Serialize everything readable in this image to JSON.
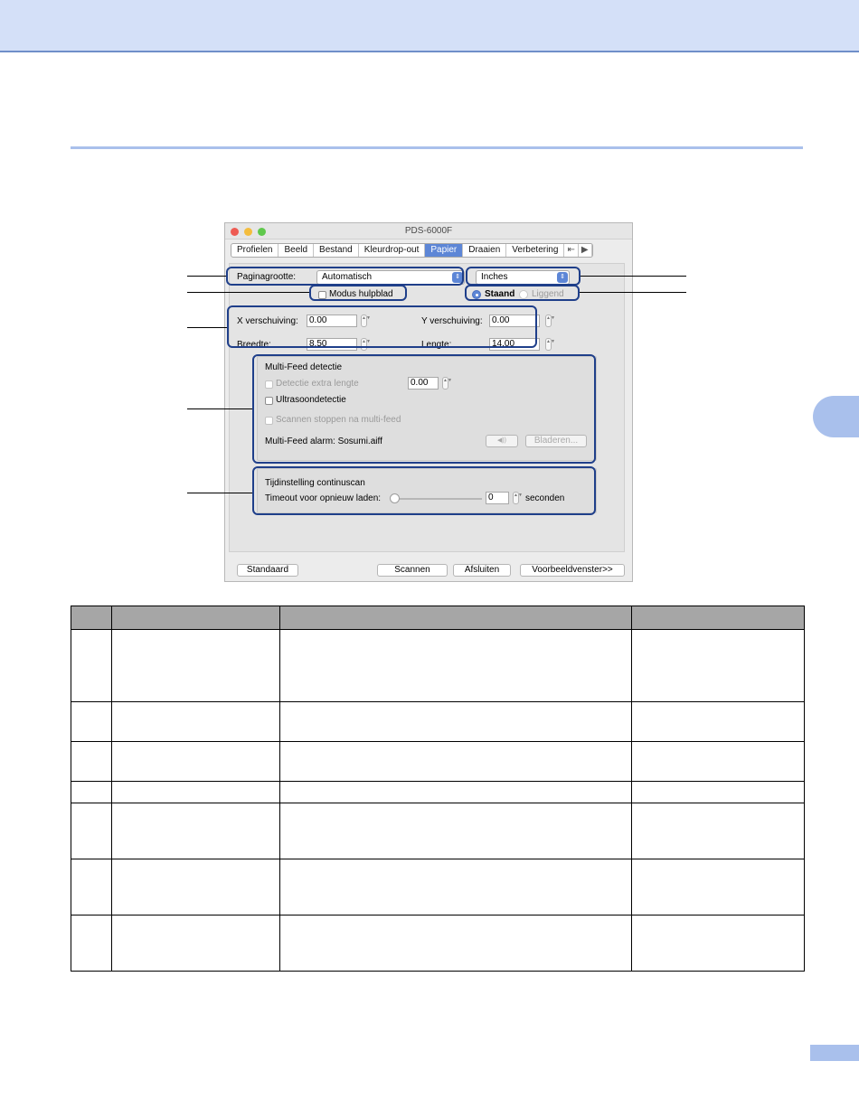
{
  "dialog": {
    "title": "PDS-6000F",
    "tabs": [
      "Profielen",
      "Beeld",
      "Bestand",
      "Kleurdrop-out",
      "Papier",
      "Draaien",
      "Verbetering"
    ],
    "tab_overflow": "⇤",
    "tab_next": "▶",
    "active_tab": "Papier",
    "paper_size_label": "Paginagrootte:",
    "paper_size_value": "Automatisch",
    "units_value": "Inches",
    "carrier_sheet_label": "Modus hulpblad",
    "orientation_portrait": "Staand",
    "orientation_landscape": "Liggend",
    "x_offset_label": "X verschuiving:",
    "x_offset_value": "0.00",
    "y_offset_label": "Y verschuiving:",
    "y_offset_value": "0.00",
    "width_label": "Breedte:",
    "width_value": "8.50",
    "length_label": "Lengte:",
    "length_value": "14.00",
    "multifeed_title": "Multi-Feed detectie",
    "extra_length_label": "Detectie extra lengte",
    "extra_length_value": "0.00",
    "ultrasonic_label": "Ultrasoondetectie",
    "stop_scan_label": "Scannen stoppen na multi-feed",
    "alarm_label": "Multi-Feed alarm: Sosumi.aiff",
    "sound_button": "◀))",
    "browse_button": "Bladeren...",
    "continuous_title": "Tijdinstelling continuscan",
    "timeout_label": "Timeout voor opnieuw laden:",
    "timeout_value": "0",
    "seconds_label": "seconden",
    "default_button": "Standaard",
    "scan_button": "Scannen",
    "close_button": "Afsluiten",
    "preview_button": "Voorbeeldvenster>>"
  },
  "colors": {
    "banner": "#d4e0f8",
    "accent": "#a9c0ec",
    "callout": "#1f3f8a",
    "table_header": "#a6a6a6",
    "active_tab": "#5d86d6"
  }
}
